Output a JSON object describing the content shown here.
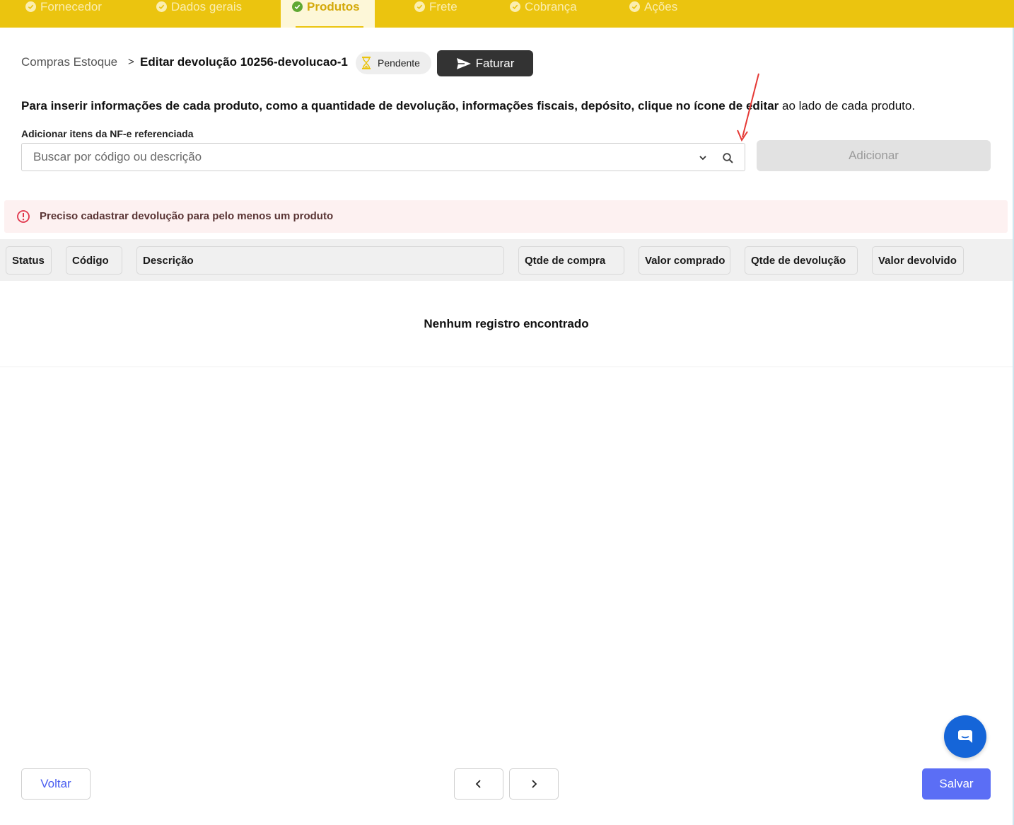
{
  "steps": [
    {
      "label": "Fornecedor",
      "active": false
    },
    {
      "label": "Dados gerais",
      "active": false
    },
    {
      "label": "Produtos",
      "active": true
    },
    {
      "label": "Frete",
      "active": false
    },
    {
      "label": "Cobrança",
      "active": false
    },
    {
      "label": "Ações",
      "active": false
    }
  ],
  "breadcrumb": {
    "root": "Compras Estoque",
    "separator": ">",
    "current": "Editar devolução 10256-devolucao-1"
  },
  "status_badge": "Pendente",
  "faturar_label": "Faturar",
  "instruction": {
    "bold": "Para inserir informações de cada produto, como a quantidade de devolução, informações fiscais, depósito, clique no ícone de editar",
    "normal": " ao lado de cada produto."
  },
  "search": {
    "label": "Adicionar itens da NF-e referenciada",
    "placeholder": "Buscar por código ou descrição",
    "value": ""
  },
  "add_label": "Adicionar",
  "alert_text": "Preciso cadastrar devolução para pelo menos um produto",
  "table": {
    "columns": [
      "Status",
      "Código",
      "Descrição",
      "Qtde de compra",
      "Valor comprado",
      "Qtde de devolução",
      "Valor devolvido"
    ],
    "empty_text": "Nenhum registro encontrado"
  },
  "footer": {
    "back_label": "Voltar",
    "save_label": "Salvar"
  },
  "colors": {
    "step_bar": "#ebc40f",
    "active_check": "#5fa833",
    "primary": "#5b6ef5",
    "chat": "#1565d8",
    "alert_icon": "#e0344a",
    "annotation_arrow": "#e53935"
  },
  "icons": [
    "check-circle-icon",
    "hourglass-icon",
    "send-icon",
    "chevron-down-icon",
    "search-icon",
    "alert-circle-icon",
    "chat-icon",
    "chevron-left-icon",
    "chevron-right-icon"
  ]
}
